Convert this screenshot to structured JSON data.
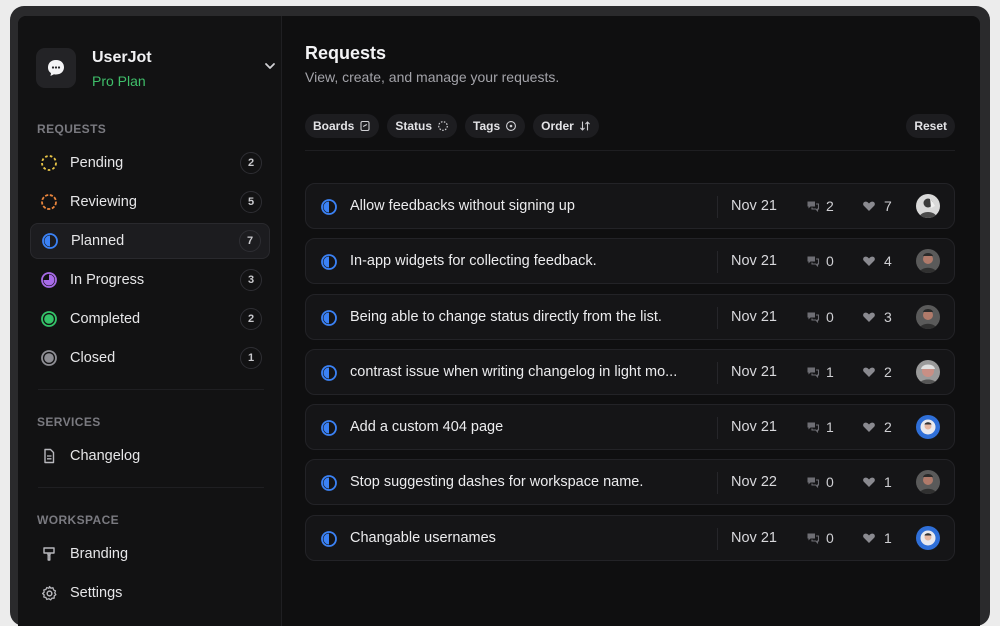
{
  "brand": {
    "name": "UserJot",
    "plan": "Pro Plan"
  },
  "sidebar": {
    "requests_label": "REQUESTS",
    "items": [
      {
        "label": "Pending",
        "count": "2"
      },
      {
        "label": "Reviewing",
        "count": "5"
      },
      {
        "label": "Planned",
        "count": "7"
      },
      {
        "label": "In Progress",
        "count": "3"
      },
      {
        "label": "Completed",
        "count": "2"
      },
      {
        "label": "Closed",
        "count": "1"
      }
    ],
    "services_label": "SERVICES",
    "services": [
      {
        "label": "Changelog"
      }
    ],
    "workspace_label": "WORKSPACE",
    "workspace": [
      {
        "label": "Branding"
      },
      {
        "label": "Settings"
      }
    ]
  },
  "main": {
    "title": "Requests",
    "subtitle": "View, create, and manage your requests.",
    "filters": [
      {
        "label": "Boards"
      },
      {
        "label": "Status"
      },
      {
        "label": "Tags"
      },
      {
        "label": "Order"
      }
    ],
    "reset_label": "Reset",
    "rows": [
      {
        "title": "Allow feedbacks without signing up",
        "date": "Nov 21",
        "comments": "2",
        "votes": "7"
      },
      {
        "title": "In-app widgets for collecting feedback.",
        "date": "Nov 21",
        "comments": "0",
        "votes": "4"
      },
      {
        "title": "Being able to change status directly from the list.",
        "date": "Nov 21",
        "comments": "0",
        "votes": "3"
      },
      {
        "title": "contrast issue when writing changelog in light mo...",
        "date": "Nov 21",
        "comments": "1",
        "votes": "2"
      },
      {
        "title": "Add a custom 404 page",
        "date": "Nov 21",
        "comments": "1",
        "votes": "2"
      },
      {
        "title": "Stop suggesting dashes for workspace name.",
        "date": "Nov 22",
        "comments": "0",
        "votes": "1"
      },
      {
        "title": "Changable usernames",
        "date": "Nov 21",
        "comments": "0",
        "votes": "1"
      }
    ]
  },
  "colors": {
    "accent_blue": "#3b82f6",
    "plan_green": "#3fbf6a",
    "pending_yellow": "#e8c547",
    "reviewing_orange": "#e8843c",
    "inprogress_purple": "#a86be8",
    "completed_green": "#34c469",
    "closed_gray": "#8e8e94"
  }
}
